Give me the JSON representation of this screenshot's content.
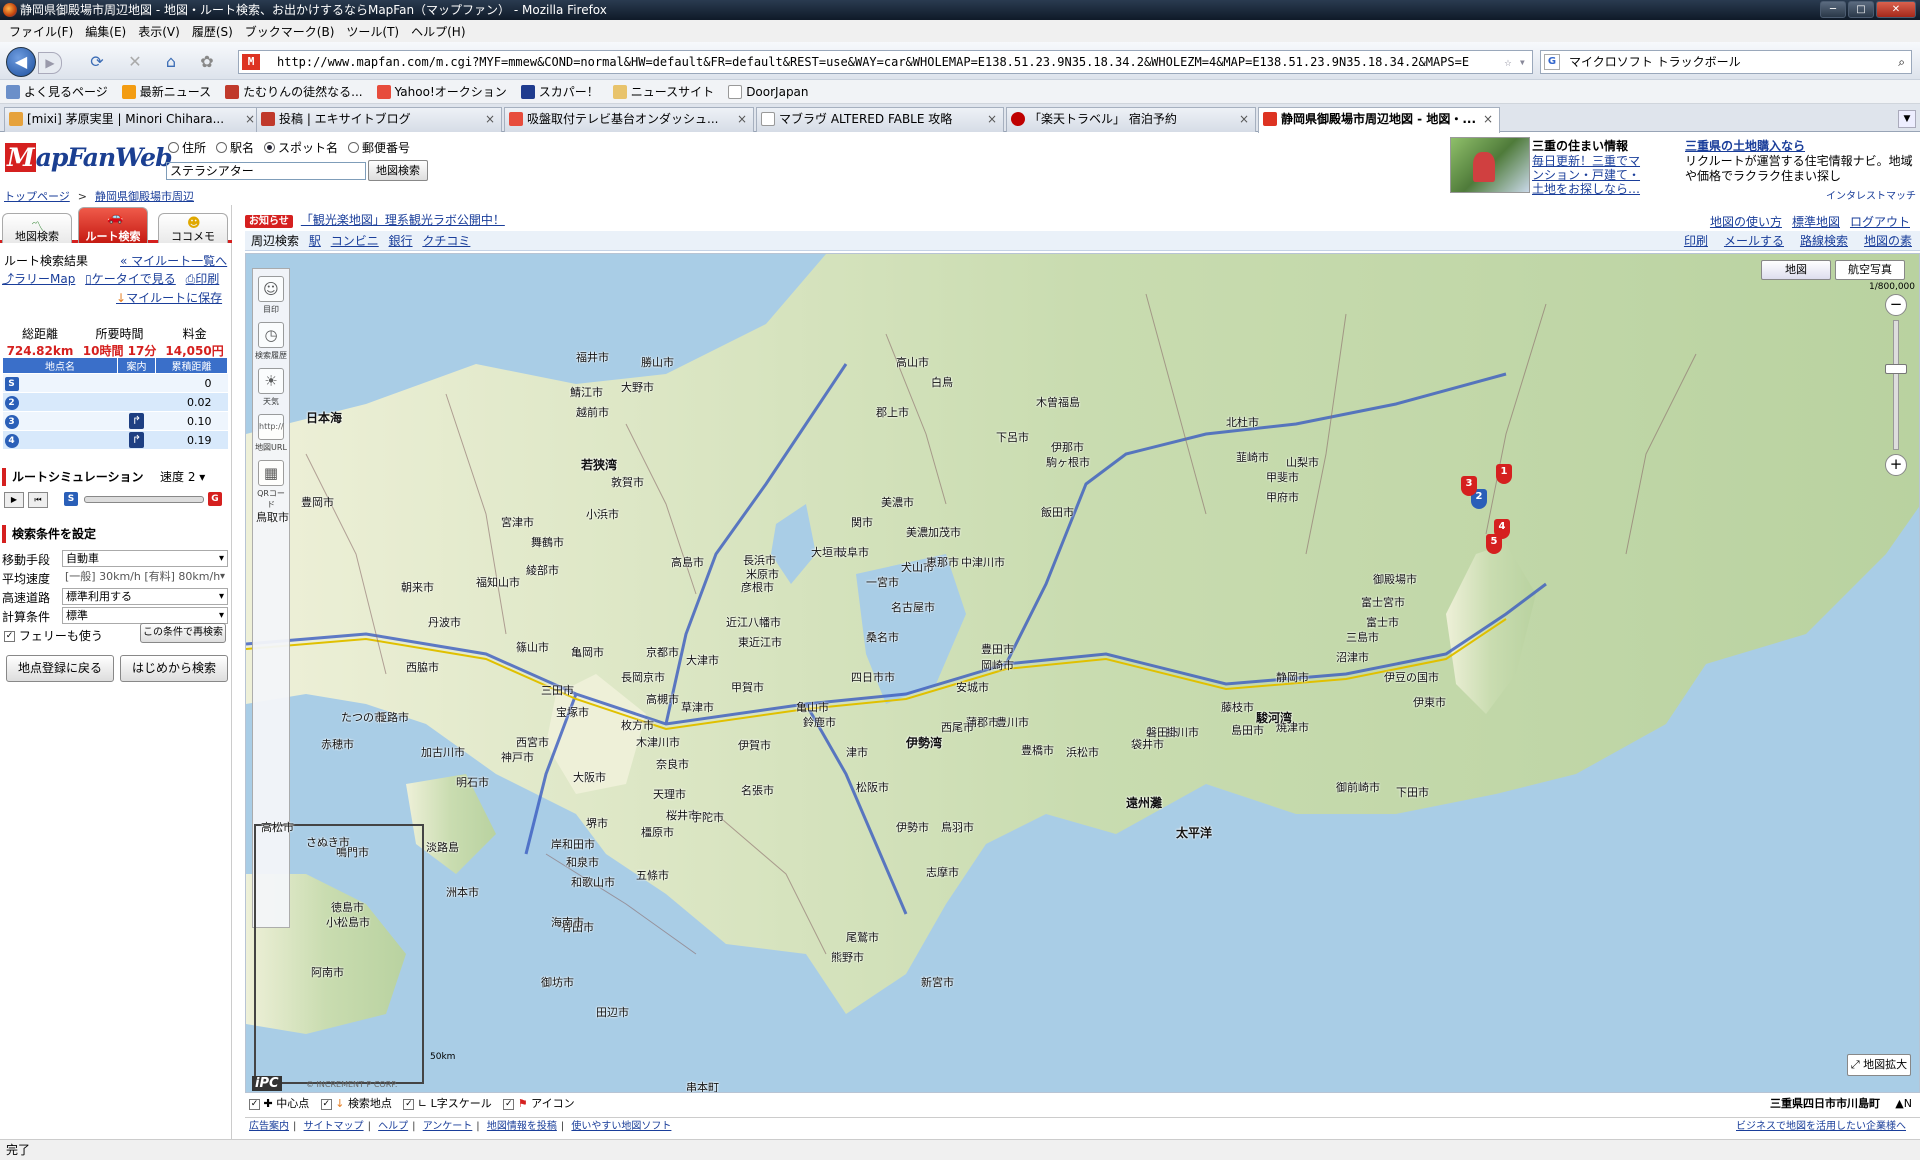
{
  "window": {
    "title": "静岡県御殿場市周辺地図 - 地図・ルート検索、お出かけするならMapFan（マップファン） - Mozilla Firefox"
  },
  "menu": [
    "ファイル(F)",
    "編集(E)",
    "表示(V)",
    "履歴(S)",
    "ブックマーク(B)",
    "ツール(T)",
    "ヘルプ(H)"
  ],
  "nav": {
    "url": "http://www.mapfan.com/m.cgi?MYF=mmew&COND=normal&HW=default&FR=default&REST=use&WAY=car&WHOLEMAP=E138.51.23.9N35.18.34.2&WHOLEZM=4&MAP=E138.51.23.9N35.18.34.2&MAPS=E",
    "search": "マイクロソフト トラックボール"
  },
  "bookmarks": [
    "よく見るページ",
    "最新ニュース",
    "たむりんの徒然なる...",
    "Yahoo!オークション",
    "スカパー！",
    "ニュースサイト",
    "DoorJapan"
  ],
  "tabs": [
    "[mixi] 茅原実里 | Minori Chihara...",
    "投稿 | エキサイトブログ",
    "吸盤取付テレビ基台オンダッシュ...",
    "マブラヴ ALTERED FABLE 攻略",
    "「楽天トラベル」 宿泊予約",
    "静岡県御殿場市周辺地図 - 地図・..."
  ],
  "page": {
    "logo": {
      "m": "M",
      "rest": "apFanWeb"
    },
    "radios": [
      "住所",
      "駅名",
      "スポット名",
      "郵便番号"
    ],
    "search_value": "ステラシアター",
    "search_button": "地図検索",
    "breadcrumb": [
      "トップページ",
      "静岡県御殿場市周辺"
    ],
    "ad": {
      "t1": "三重の住まい情報",
      "t2": "毎日更新！三重でマンション・戸建て・土地をお探しなら…",
      "t3": "三重県の土地購入なら",
      "t4": "リクルートが運営する住宅情報ナビ。地域や価格でラクラク住まい探し",
      "t5": "インタレストマッチ"
    },
    "notice": {
      "badge": "お知らせ",
      "text": "「観光楽地図」理系観光ラボ公開中！"
    },
    "rightlinks": [
      "地図の使い方",
      "標準地図",
      "ログアウト"
    ],
    "maptools": {
      "label": "周辺検索",
      "items": [
        "駅",
        "コンビニ",
        "銀行",
        "クチコミ"
      ],
      "right": [
        "印刷",
        "メールする",
        "路線検索",
        "地図の素"
      ]
    }
  },
  "left": {
    "tabs": [
      "地図検索",
      "ルート検索",
      "ココメモ"
    ],
    "result_title": "ルート検索結果",
    "mylist": "マイルート一覧へ",
    "links": [
      "ラリーMap",
      "ケータイで見る",
      "印刷"
    ],
    "save": "マイルートに保存",
    "summary": {
      "h": [
        "総距離",
        "所要時間",
        "料金"
      ],
      "v": [
        "724.82km",
        "10時間 17分",
        "14,050円"
      ]
    },
    "points": {
      "h": [
        "地点名",
        "案内",
        "累積距離"
      ],
      "rows": [
        {
          "n": "S",
          "d": "0"
        },
        {
          "n": "2",
          "d": "0.02"
        },
        {
          "n": "3",
          "d": "0.10"
        },
        {
          "n": "4",
          "d": "0.19"
        }
      ]
    },
    "sim": {
      "title": "ルートシミュレーション",
      "speed": "速度 2"
    },
    "cond": {
      "title": "検索条件を設定",
      "rows": [
        {
          "l": "移動手段",
          "v": "自動車"
        },
        {
          "l": "平均速度",
          "v": "[一般] 30km/h [有料] 80km/h"
        },
        {
          "l": "高速道路",
          "v": "標準利用する"
        },
        {
          "l": "計算条件",
          "v": "標準"
        }
      ],
      "ferry": "フェリーも使う",
      "retry": "この条件で再検索"
    },
    "btn_back": "地点登録に戻る",
    "btn_start": "はじめから検索"
  },
  "map": {
    "btns": [
      "地図",
      "航空写真"
    ],
    "scale": "1/800,000",
    "tools": [
      "目印",
      "検索履歴",
      "天気",
      "地図URL",
      "QRコード"
    ],
    "mini_scale": "50km",
    "ipc": "iPC",
    "copy": "© INCREMENT P CORP.",
    "expand": "地図拡大",
    "cities": [
      [
        "福井市",
        70,
        25
      ],
      [
        "鯖江市",
        64,
        60
      ],
      [
        "越前市",
        70,
        80
      ],
      [
        "大野市",
        115,
        55
      ],
      [
        "勝山市",
        135,
        30
      ],
      [
        "敦賀市",
        105,
        150
      ],
      [
        "日本海",
        -200,
        85
      ],
      [
        "若狭湾",
        75,
        132
      ],
      [
        "小浜市",
        80,
        182
      ],
      [
        "舞鶴市",
        25,
        210
      ],
      [
        "宮津市",
        -5,
        190
      ],
      [
        "豊岡市",
        -205,
        170
      ],
      [
        "鳥取市",
        -250,
        185
      ],
      [
        "福知山市",
        -30,
        250
      ],
      [
        "綾部市",
        20,
        238
      ],
      [
        "朝来市",
        -105,
        255
      ],
      [
        "丹波市",
        -78,
        290
      ],
      [
        "西脇市",
        -100,
        335
      ],
      [
        "篠山市",
        10,
        315
      ],
      [
        "亀岡市",
        65,
        320
      ],
      [
        "京都市",
        140,
        320
      ],
      [
        "大津市",
        180,
        328
      ],
      [
        "高島市",
        165,
        230
      ],
      [
        "長浜市",
        237,
        228
      ],
      [
        "彦根市",
        235,
        255
      ],
      [
        "米原市",
        240,
        242
      ],
      [
        "近江八幡市",
        220,
        290
      ],
      [
        "東近江市",
        232,
        310
      ],
      [
        "甲賀市",
        225,
        355
      ],
      [
        "草津市",
        175,
        375
      ],
      [
        "長岡京市",
        115,
        345
      ],
      [
        "枚方市",
        115,
        393
      ],
      [
        "高槻市",
        140,
        367
      ],
      [
        "宝塚市",
        50,
        380
      ],
      [
        "三田市",
        35,
        358
      ],
      [
        "西宮市",
        10,
        410
      ],
      [
        "神戸市",
        -5,
        425
      ],
      [
        "明石市",
        -50,
        450
      ],
      [
        "加古川市",
        -85,
        420
      ],
      [
        "姫路市",
        -130,
        385
      ],
      [
        "たつの市",
        -165,
        385
      ],
      [
        "赤穂市",
        -185,
        412
      ],
      [
        "大阪市",
        67,
        445
      ],
      [
        "堺市",
        80,
        491
      ],
      [
        "和泉市",
        60,
        530
      ],
      [
        "岸和田市",
        45,
        512
      ],
      [
        "木津川市",
        130,
        410
      ],
      [
        "奈良市",
        150,
        432
      ],
      [
        "天理市",
        147,
        462
      ],
      [
        "橿原市",
        135,
        500
      ],
      [
        "五條市",
        130,
        543
      ],
      [
        "桜井市",
        160,
        483
      ],
      [
        "宇陀市",
        185,
        485
      ],
      [
        "名張市",
        235,
        458
      ],
      [
        "伊賀市",
        232,
        413
      ],
      [
        "鈴鹿市",
        297,
        390
      ],
      [
        "亀山市",
        290,
        375
      ],
      [
        "津市",
        340,
        420
      ],
      [
        "松阪市",
        350,
        455
      ],
      [
        "伊勢市",
        390,
        495
      ],
      [
        "鳥羽市",
        435,
        495
      ],
      [
        "志摩市",
        420,
        540
      ],
      [
        "伊勢湾",
        400,
        410
      ],
      [
        "四日市市",
        345,
        345
      ],
      [
        "桑名市",
        360,
        305
      ],
      [
        "岐阜市",
        330,
        220
      ],
      [
        "大垣市",
        305,
        220
      ],
      [
        "関市",
        345,
        190
      ],
      [
        "美濃加茂市",
        400,
        200
      ],
      [
        "美濃市",
        375,
        170
      ],
      [
        "犬山市",
        395,
        235
      ],
      [
        "一宮市",
        360,
        250
      ],
      [
        "名古屋市",
        385,
        275
      ],
      [
        "岡崎市",
        475,
        333
      ],
      [
        "豊田市",
        475,
        317
      ],
      [
        "豊橋市",
        515,
        418
      ],
      [
        "豊川市",
        490,
        390
      ],
      [
        "蒲郡市",
        460,
        390
      ],
      [
        "西尾市",
        435,
        395
      ],
      [
        "安城市",
        450,
        355
      ],
      [
        "浜松市",
        560,
        420
      ],
      [
        "磐田市",
        640,
        400
      ],
      [
        "掛川市",
        660,
        400
      ],
      [
        "袋井市",
        625,
        412
      ],
      [
        "島田市",
        725,
        398
      ],
      [
        "藤枝市",
        715,
        375
      ],
      [
        "焼津市",
        770,
        395
      ],
      [
        "静岡市",
        770,
        345
      ],
      [
        "富士市",
        860,
        290
      ],
      [
        "富士宮市",
        855,
        270
      ],
      [
        "沼津市",
        830,
        325
      ],
      [
        "三島市",
        840,
        305
      ],
      [
        "御殿場市",
        867,
        247
      ],
      [
        "伊豆の国市",
        878,
        345
      ],
      [
        "伊東市",
        907,
        370
      ],
      [
        "下田市",
        890,
        460
      ],
      [
        "御前崎市",
        830,
        455
      ],
      [
        "駿河湾",
        750,
        385
      ],
      [
        "遠州灘",
        620,
        470
      ],
      [
        "太平洋",
        670,
        500
      ],
      [
        "甲府市",
        760,
        165
      ],
      [
        "山梨市",
        780,
        130
      ],
      [
        "韮崎市",
        730,
        125
      ],
      [
        "甲斐市",
        760,
        145
      ],
      [
        "北杜市",
        720,
        90
      ],
      [
        "飯田市",
        535,
        180
      ],
      [
        "中津川市",
        455,
        230
      ],
      [
        "恵那市",
        420,
        230
      ],
      [
        "伊那市",
        545,
        115
      ],
      [
        "駒ヶ根市",
        540,
        130
      ],
      [
        "木曽福島",
        530,
        70
      ],
      [
        "高山市",
        390,
        30
      ],
      [
        "郡上市",
        370,
        80
      ],
      [
        "下呂市",
        490,
        105
      ],
      [
        "白鳥",
        425,
        50
      ],
      [
        "和歌山市",
        65,
        550
      ],
      [
        "有田市",
        55,
        595
      ],
      [
        "海南市",
        45,
        590
      ],
      [
        "御坊市",
        35,
        650
      ],
      [
        "田辺市",
        90,
        680
      ],
      [
        "新宮市",
        415,
        650
      ],
      [
        "熊野市",
        325,
        625
      ],
      [
        "尾鷲市",
        340,
        605
      ],
      [
        "串本町",
        180,
        755
      ],
      [
        "淡路島",
        -80,
        515
      ],
      [
        "洲本市",
        -60,
        560
      ],
      [
        "鳴門市",
        -170,
        520
      ],
      [
        "徳島市",
        -175,
        575
      ],
      [
        "阿南市",
        -195,
        640
      ],
      [
        "小松島市",
        -180,
        590
      ],
      [
        "さぬき市",
        -200,
        510
      ],
      [
        "高松市",
        -245,
        495
      ]
    ],
    "markers": [
      [
        "1",
        905,
        220
      ],
      [
        "2",
        880,
        245
      ],
      [
        "3",
        870,
        232
      ],
      [
        "4",
        903,
        275
      ],
      [
        "5",
        895,
        290
      ]
    ],
    "footer_items": [
      "中心点",
      "検索地点",
      "L字スケール",
      "アイコン"
    ],
    "address": "三重県四日市市川島町",
    "north": "N"
  },
  "sitefoot": {
    "items": [
      "広告案内",
      "サイトマップ",
      "ヘルプ",
      "アンケート",
      "地図情報を投稿",
      "使いやすい地図ソフト"
    ],
    "right": "ビジネスで地図を活用したい企業様へ"
  },
  "status": "完了"
}
